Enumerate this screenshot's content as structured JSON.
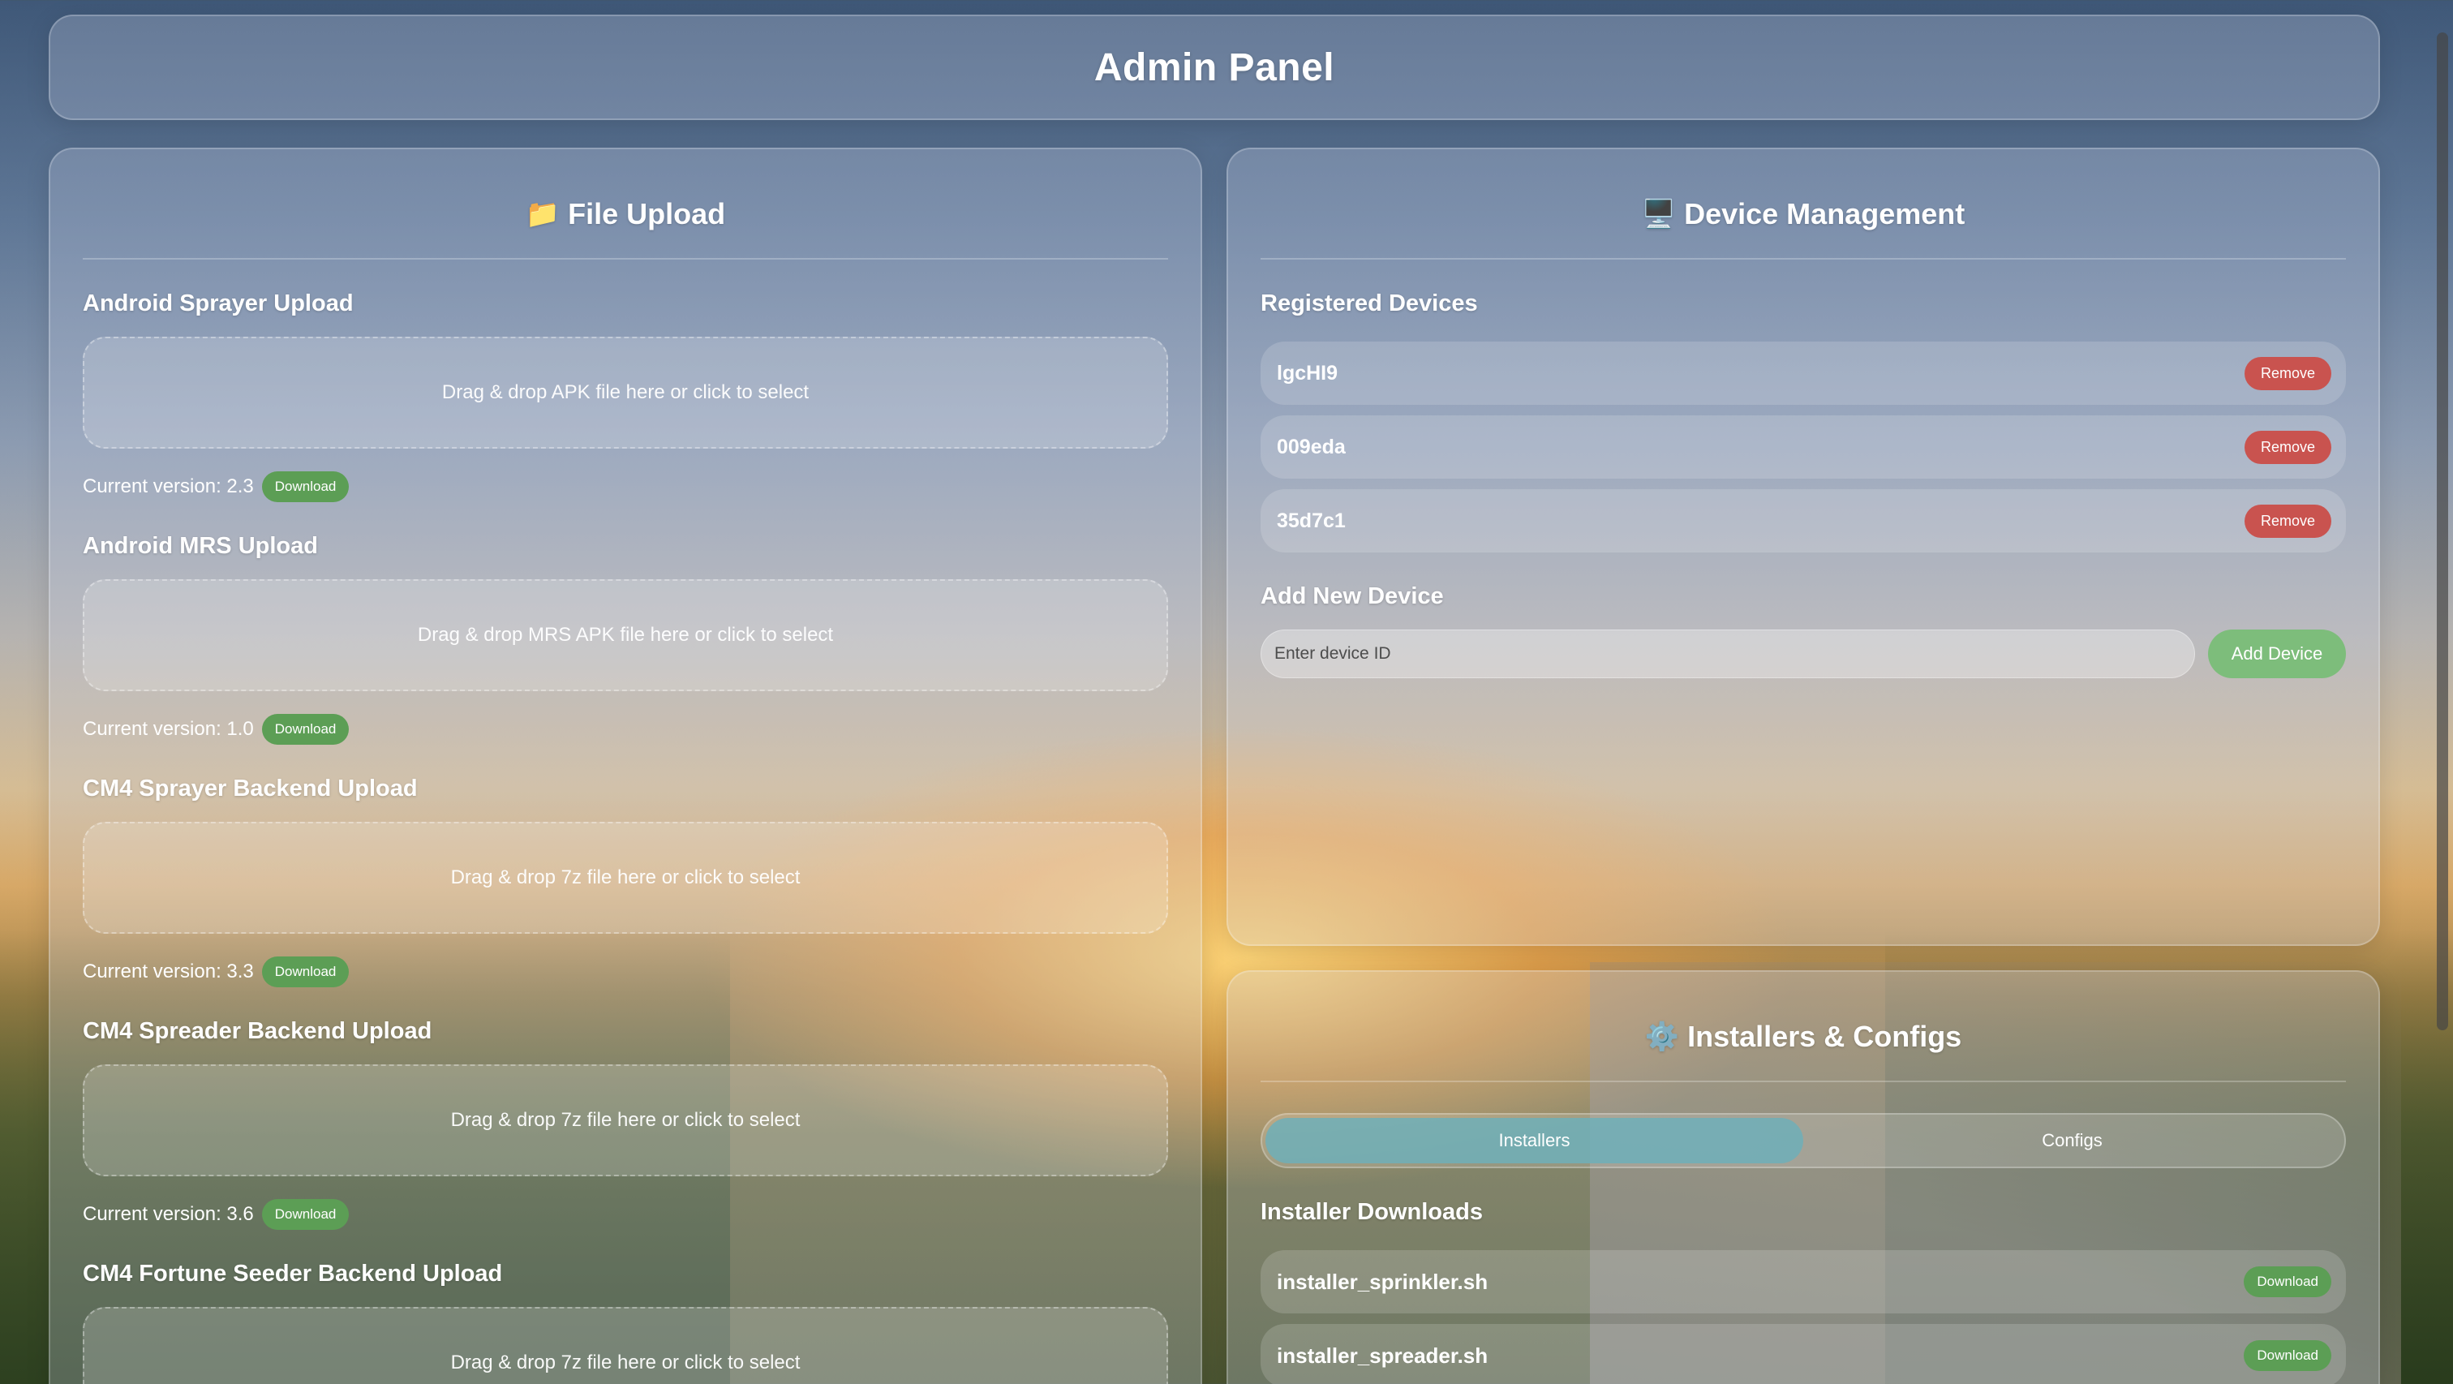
{
  "header": {
    "title": "Admin Panel"
  },
  "file_upload": {
    "title": "File Upload",
    "icon": "folder-icon",
    "sections": [
      {
        "title": "Android Sprayer Upload",
        "dropzone": "Drag & drop APK file here or click to select",
        "version": "Current version: 2.3",
        "button": "Download"
      },
      {
        "title": "Android MRS Upload",
        "dropzone": "Drag & drop MRS APK file here or click to select",
        "version": "Current version: 1.0",
        "button": "Download"
      },
      {
        "title": "CM4 Sprayer Backend Upload",
        "dropzone": "Drag & drop 7z file here or click to select",
        "version": "Current version: 3.3",
        "button": "Download"
      },
      {
        "title": "CM4 Spreader Backend Upload",
        "dropzone": "Drag & drop 7z file here or click to select",
        "version": "Current version: 3.6",
        "button": "Download"
      },
      {
        "title": "CM4 Fortune Seeder Backend Upload",
        "dropzone": "Drag & drop 7z file here or click to select"
      }
    ]
  },
  "device_management": {
    "title": "Device Management",
    "icon": "monitor-icon",
    "registered_title": "Registered Devices",
    "devices": [
      {
        "id": "lgcHI9",
        "button": "Remove"
      },
      {
        "id": "009eda",
        "button": "Remove"
      },
      {
        "id": "35d7c1",
        "button": "Remove"
      }
    ],
    "add_title": "Add New Device",
    "input_placeholder": "Enter device ID",
    "add_button": "Add Device"
  },
  "installers": {
    "title": "Installers & Configs",
    "icon": "gear-icon",
    "tabs": [
      {
        "label": "Installers",
        "active": true
      },
      {
        "label": "Configs",
        "active": false
      }
    ],
    "downloads_title": "Installer Downloads",
    "items": [
      {
        "name": "installer_sprinkler.sh",
        "button": "Download"
      },
      {
        "name": "installer_spreader.sh",
        "button": "Download"
      }
    ]
  },
  "colors": {
    "download_green": "#5c9e55",
    "remove_red": "#c9534f",
    "add_green": "#7dbd7b",
    "active_tab": "#6eafb9"
  }
}
